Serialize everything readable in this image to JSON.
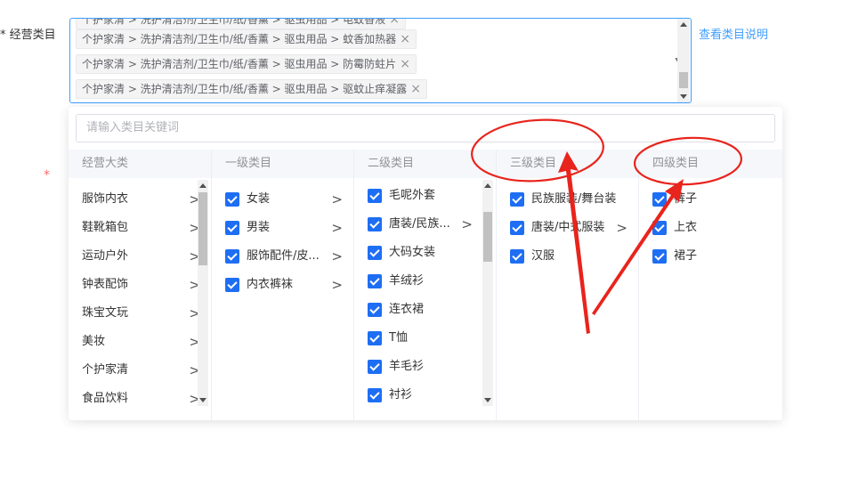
{
  "form": {
    "label": "* 经营类目",
    "help_link": "查看类目说明"
  },
  "selected_tags": [
    {
      "text": "个护家清 > 洗护清洁剂/卫生巾/纸/香薰 > 驱虫用品 > 电蚊香液"
    },
    {
      "text": "个护家清 > 洗护清洁剂/卫生巾/纸/香薰 > 驱虫用品 > 蚊香加热器"
    },
    {
      "text": "个护家清 > 洗护清洁剂/卫生巾/纸/香薰 > 驱虫用品 > 防霉防蛀片"
    },
    {
      "text": "个护家清 > 洗护清洁剂/卫生巾/纸/香薰 > 驱虫用品 > 驱蚊止痒凝露"
    }
  ],
  "tag_close_glyph": "×",
  "search": {
    "placeholder": "请输入类目关键词"
  },
  "columns": {
    "main": {
      "header": "经营大类",
      "items": [
        "服饰内衣",
        "鞋靴箱包",
        "运动户外",
        "钟表配饰",
        "珠宝文玩",
        "美妆",
        "个护家清",
        "食品饮料"
      ]
    },
    "level1": {
      "header": "一级类目",
      "items": [
        "女装",
        "男装",
        "服饰配件/皮...",
        "内衣裤袜"
      ]
    },
    "level2": {
      "header": "二级类目",
      "items": [
        "毛呢外套",
        "唐装/民族...",
        "大码女装",
        "羊绒衫",
        "连衣裙",
        "T恤",
        "羊毛衫",
        "衬衫"
      ]
    },
    "level3": {
      "header": "三级类目",
      "items": [
        "民族服装/舞台装",
        "唐装/中式服装",
        "汉服"
      ]
    },
    "level4": {
      "header": "四级类目",
      "items": [
        "裤子",
        "上衣",
        "裙子"
      ]
    }
  },
  "colors": {
    "accent": "#409eff",
    "checkbox": "#1e6ef4",
    "annotation": "#e8241c"
  }
}
